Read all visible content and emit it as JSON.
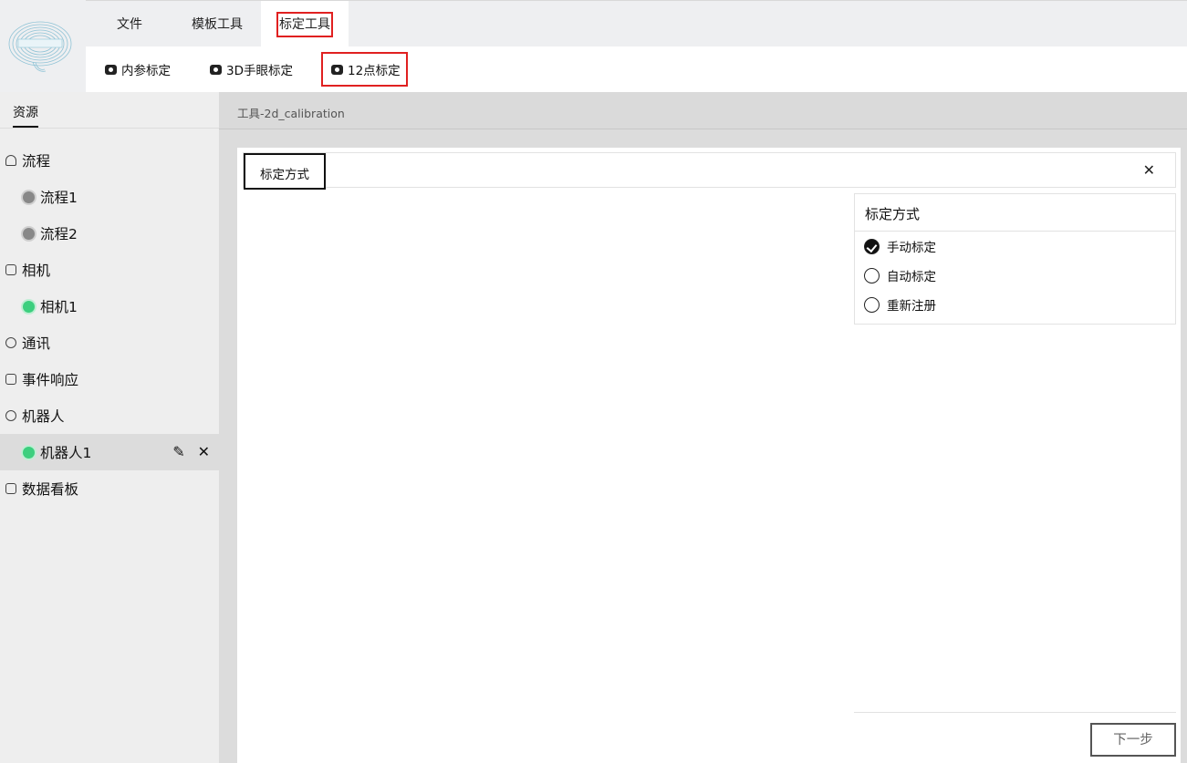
{
  "menu": {
    "tabs": [
      {
        "label": "文件"
      },
      {
        "label": "模板工具"
      },
      {
        "label": "标定工具",
        "active": true
      }
    ]
  },
  "toolbar": {
    "buttons": [
      {
        "label": "内参标定"
      },
      {
        "label": "3D手眼标定"
      },
      {
        "label": "12点标定",
        "highlighted": true
      }
    ]
  },
  "sidebar": {
    "tab": "资源",
    "items": [
      {
        "label": "流程",
        "kind": "category",
        "icon": "bell-icon"
      },
      {
        "label": "流程1",
        "kind": "leaf",
        "status": "gray"
      },
      {
        "label": "流程2",
        "kind": "leaf",
        "status": "gray"
      },
      {
        "label": "相机",
        "kind": "category",
        "icon": "camera-icon"
      },
      {
        "label": "相机1",
        "kind": "leaf",
        "status": "green"
      },
      {
        "label": "通讯",
        "kind": "category",
        "icon": "communication-icon"
      },
      {
        "label": "事件响应",
        "kind": "category",
        "icon": "document-icon"
      },
      {
        "label": "机器人",
        "kind": "category",
        "icon": "robot-icon"
      },
      {
        "label": "机器人1",
        "kind": "leaf",
        "status": "green",
        "selected": true
      },
      {
        "label": "数据看板",
        "kind": "category",
        "icon": "dashboard-icon"
      }
    ],
    "row_actions": {
      "edit_glyph": "✎",
      "close_glyph": "✕"
    }
  },
  "content": {
    "breadcrumb": "工具-2d_calibration",
    "panel": {
      "tab_label": "标定方式",
      "close_glyph": "✕",
      "method": {
        "title": "标定方式",
        "options": [
          {
            "label": "手动标定",
            "checked": true
          },
          {
            "label": "自动标定",
            "checked": false
          },
          {
            "label": "重新注册",
            "checked": false
          }
        ]
      },
      "next_label": "下一步"
    }
  },
  "colors": {
    "highlight_border": "#e02020",
    "status_green": "#3ccf7e",
    "status_gray": "#888888"
  }
}
